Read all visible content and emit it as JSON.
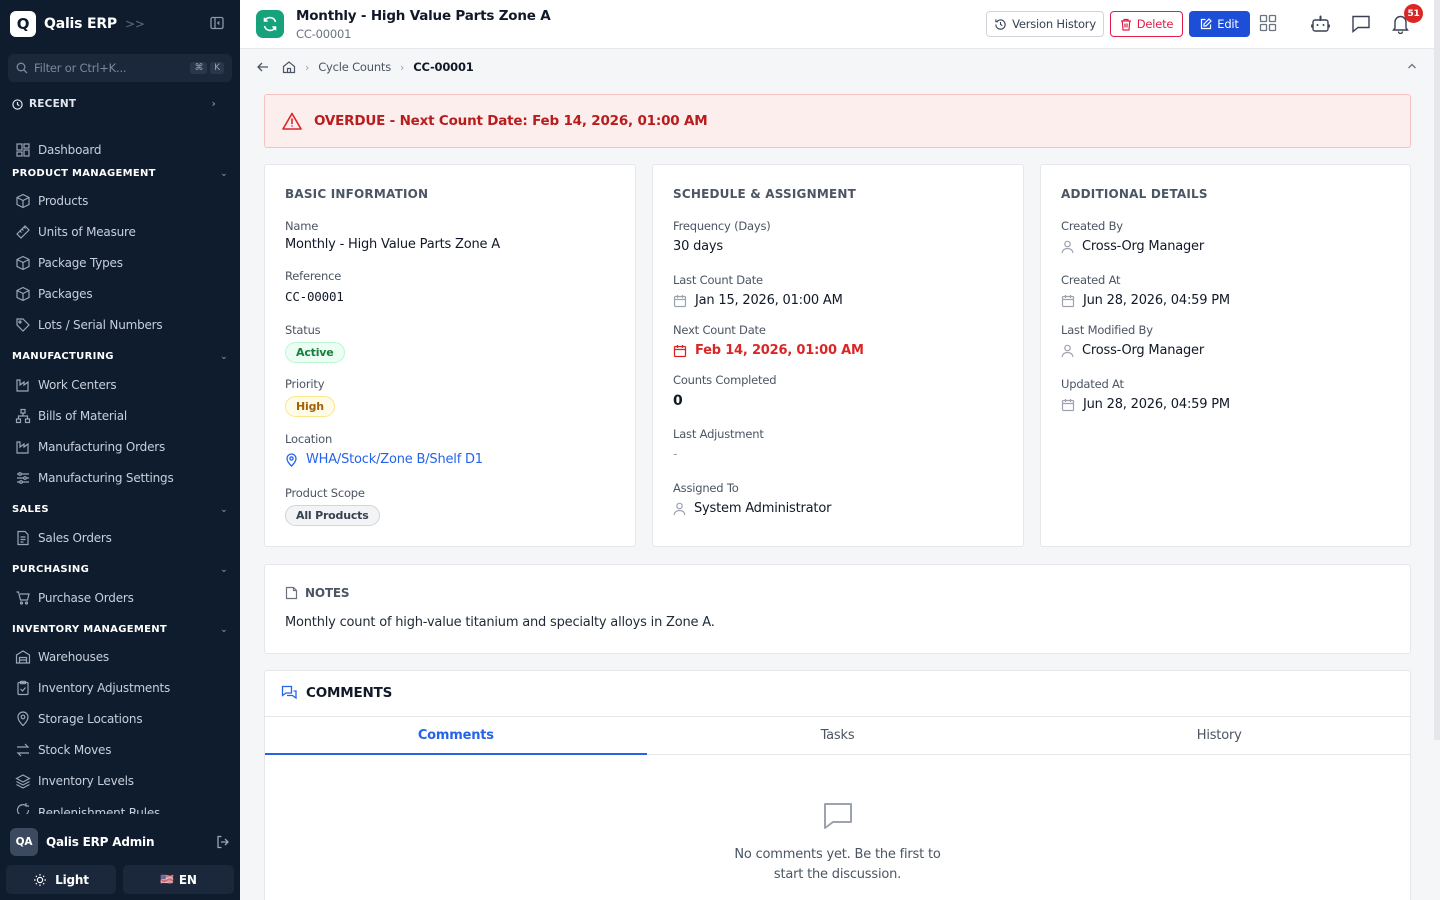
{
  "app": {
    "logo_letter": "Q",
    "name": "Qalis ERP"
  },
  "sidebar": {
    "filter_placeholder": "Filter or Ctrl+K...",
    "kbd": [
      "⌘",
      "K"
    ],
    "recent_label": "RECENT",
    "dashboard": "Dashboard",
    "sections": {
      "product": {
        "label": "PRODUCT MANAGEMENT",
        "items": [
          "Products",
          "Units of Measure",
          "Package Types",
          "Packages",
          "Lots / Serial Numbers"
        ]
      },
      "manufacturing": {
        "label": "MANUFACTURING",
        "items": [
          "Work Centers",
          "Bills of Material",
          "Manufacturing Orders",
          "Manufacturing Settings"
        ]
      },
      "sales": {
        "label": "SALES",
        "items": [
          "Sales Orders"
        ]
      },
      "purchasing": {
        "label": "PURCHASING",
        "items": [
          "Purchase Orders"
        ]
      },
      "inventory": {
        "label": "INVENTORY MANAGEMENT",
        "items": [
          "Warehouses",
          "Inventory Adjustments",
          "Storage Locations",
          "Stock Moves",
          "Inventory Levels",
          "Replenishment Rules"
        ]
      }
    },
    "user": {
      "initials": "QA",
      "name": "Qalis ERP Admin"
    },
    "theme_label": "Light",
    "lang_flag": "🇺🇸",
    "lang_label": "EN"
  },
  "header": {
    "title": "Monthly - High Value Parts Zone A",
    "subtitle": "CC-00001",
    "version_history": "Version History",
    "delete": "Delete",
    "edit": "Edit",
    "notification_count": "51"
  },
  "breadcrumb": {
    "parent": "Cycle Counts",
    "current": "CC-00001"
  },
  "alert": {
    "text": "OVERDUE - Next Count Date: Feb 14, 2026, 01:00 AM"
  },
  "basic": {
    "title": "BASIC INFORMATION",
    "name_label": "Name",
    "name": "Monthly - High Value Parts Zone A",
    "reference_label": "Reference",
    "reference": "CC-00001",
    "status_label": "Status",
    "status": "Active",
    "priority_label": "Priority",
    "priority": "High",
    "location_label": "Location",
    "location": "WHA/Stock/Zone B/Shelf D1",
    "scope_label": "Product Scope",
    "scope": "All Products"
  },
  "schedule": {
    "title": "SCHEDULE & ASSIGNMENT",
    "frequency_label": "Frequency (Days)",
    "frequency": "30 days",
    "last_count_label": "Last Count Date",
    "last_count": "Jan 15, 2026, 01:00 AM",
    "next_count_label": "Next Count Date",
    "next_count": "Feb 14, 2026, 01:00 AM",
    "counts_label": "Counts Completed",
    "counts": "0",
    "adjustment_label": "Last Adjustment",
    "adjustment": "-",
    "assigned_label": "Assigned To",
    "assigned": "System Administrator"
  },
  "additional": {
    "title": "ADDITIONAL DETAILS",
    "created_by_label": "Created By",
    "created_by": "Cross-Org Manager",
    "created_at_label": "Created At",
    "created_at": "Jun 28, 2026, 04:59 PM",
    "modified_by_label": "Last Modified By",
    "modified_by": "Cross-Org Manager",
    "updated_at_label": "Updated At",
    "updated_at": "Jun 28, 2026, 04:59 PM"
  },
  "notes": {
    "title": "NOTES",
    "text": "Monthly count of high-value titanium and specialty alloys in Zone A."
  },
  "comments": {
    "title": "COMMENTS",
    "tabs": [
      "Comments",
      "Tasks",
      "History"
    ],
    "empty_line1": "No comments yet. Be the first to",
    "empty_line2": "start the discussion."
  },
  "colors": {
    "sidebar_bg": "#0f1c2e",
    "primary": "#1d4ed8",
    "danger": "#dc2626",
    "success": "#16a37b"
  }
}
